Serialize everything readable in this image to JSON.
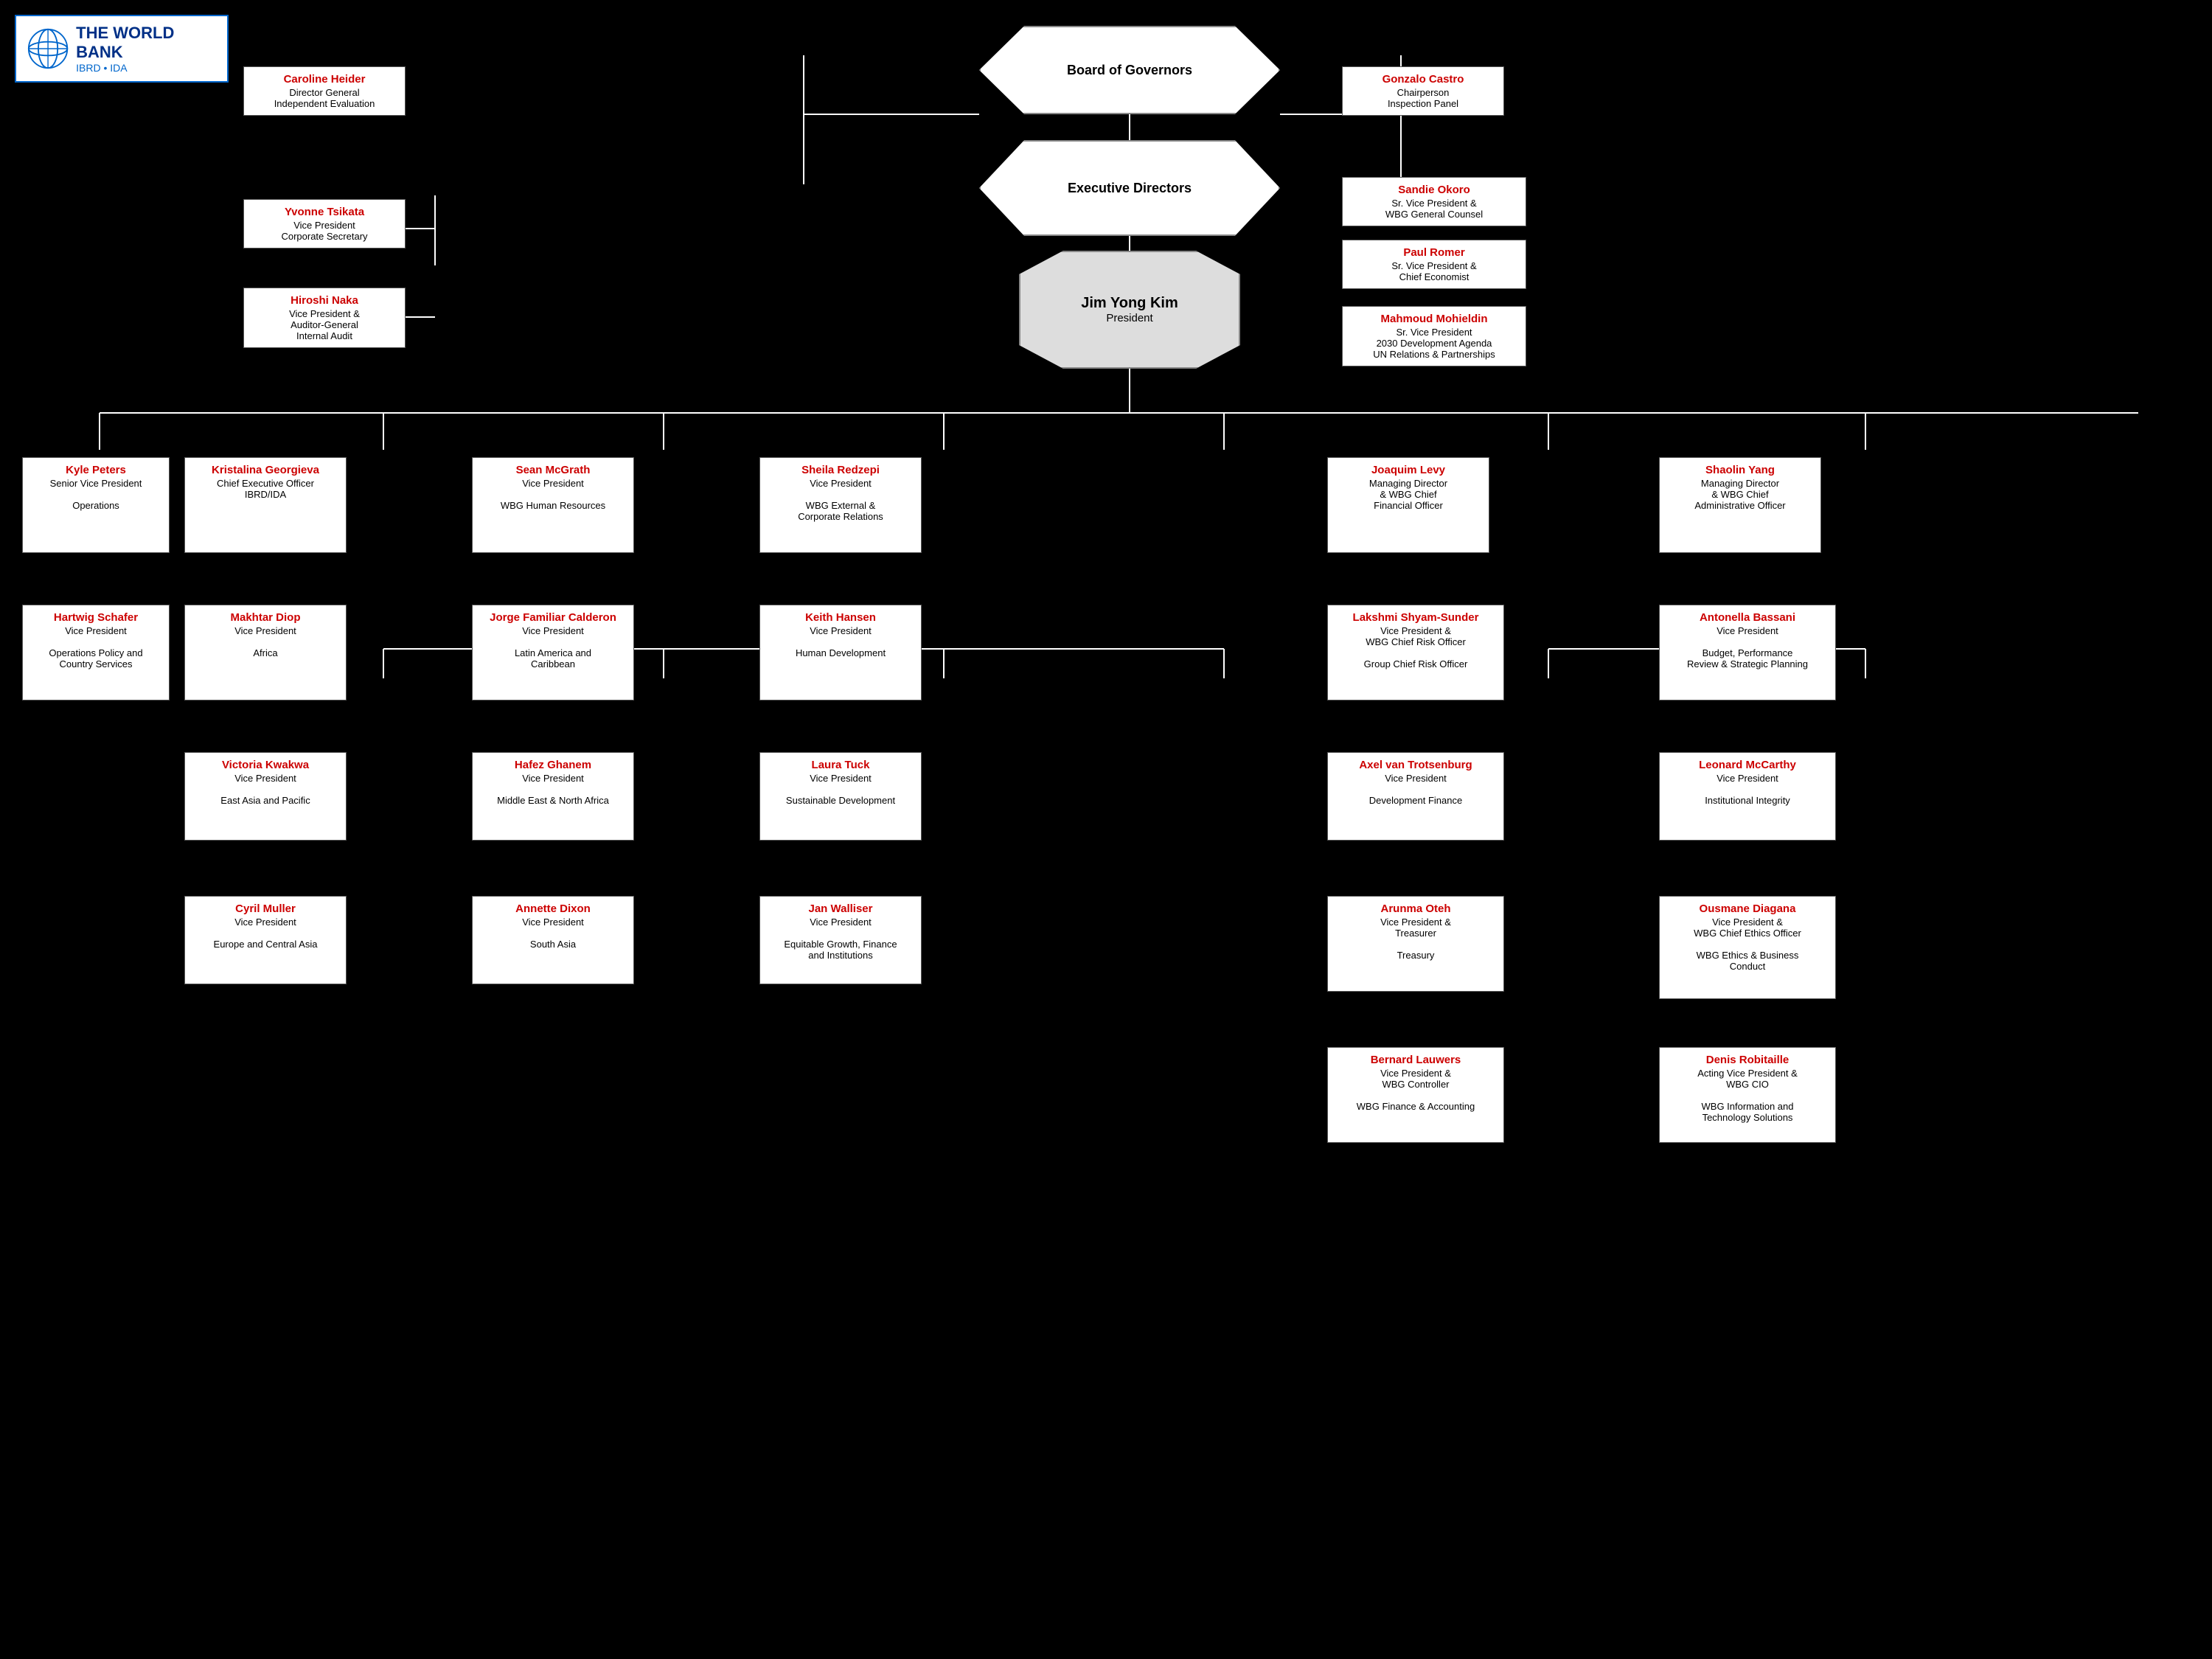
{
  "logo": {
    "title": "THE WORLD BANK",
    "sub": "IBRD • IDA"
  },
  "board": {
    "label": "Board of Governors"
  },
  "exec_directors": {
    "label": "Executive Directors"
  },
  "president": {
    "name": "Jim Yong Kim",
    "title": "President"
  },
  "cards": {
    "caroline": {
      "name": "Caroline Heider",
      "lines": [
        "Director General",
        "Independent Evaluation"
      ]
    },
    "yvonne": {
      "name": "Yvonne Tsikata",
      "lines": [
        "Vice President",
        "Corporate Secretary"
      ]
    },
    "hiroshi": {
      "name": "Hiroshi Naka",
      "lines": [
        "Vice President &",
        "Auditor-General",
        "Internal Audit"
      ]
    },
    "gonzalo": {
      "name": "Gonzalo Castro",
      "lines": [
        "Chairperson",
        "Inspection Panel"
      ]
    },
    "sandie": {
      "name": "Sandie Okoro",
      "lines": [
        "Sr. Vice President &",
        "WBG General Counsel"
      ]
    },
    "paul": {
      "name": "Paul Romer",
      "lines": [
        "Sr. Vice President &",
        "Chief Economist"
      ]
    },
    "mahmoud": {
      "name": "Mahmoud Mohieldin",
      "lines": [
        "Sr. Vice President",
        "2030 Development Agenda",
        "UN Relations & Partnerships"
      ]
    },
    "kyle": {
      "name": "Kyle Peters",
      "lines": [
        "Senior Vice President",
        "",
        "Operations"
      ]
    },
    "kristalina": {
      "name": "Kristalina Georgieva",
      "lines": [
        "Chief Executive Officer",
        "IBRD/IDA"
      ]
    },
    "sean": {
      "name": "Sean McGrath",
      "lines": [
        "Vice President",
        "",
        "WBG Human Resources"
      ]
    },
    "sheila": {
      "name": "Sheila Redzepi",
      "lines": [
        "Vice President",
        "",
        "WBG External &",
        "Corporate Relations"
      ]
    },
    "joaquim": {
      "name": "Joaquim Levy",
      "lines": [
        "Managing Director",
        "& WBG Chief",
        "Financial Officer"
      ]
    },
    "shaolin": {
      "name": "Shaolin Yang",
      "lines": [
        "Managing Director",
        "& WBG Chief",
        "Administrative Officer"
      ]
    },
    "hartwig": {
      "name": "Hartwig Schafer",
      "lines": [
        "Vice President",
        "",
        "Operations Policy and",
        "Country Services"
      ]
    },
    "makhtar": {
      "name": "Makhtar Diop",
      "lines": [
        "Vice President",
        "",
        "Africa"
      ]
    },
    "jorge": {
      "name": "Jorge Familiar Calderon",
      "lines": [
        "Vice President",
        "",
        "Latin America and",
        "Caribbean"
      ]
    },
    "keith": {
      "name": "Keith Hansen",
      "lines": [
        "Vice President",
        "",
        "Human Development"
      ]
    },
    "lakshmi": {
      "name": "Lakshmi Shyam-Sunder",
      "lines": [
        "Vice President &",
        "WBG Chief Risk Officer",
        "",
        "Group Chief Risk Officer"
      ]
    },
    "antonella": {
      "name": "Antonella Bassani",
      "lines": [
        "Vice President",
        "",
        "Budget, Performance",
        "Review & Strategic Planning"
      ]
    },
    "victoria": {
      "name": "Victoria Kwakwa",
      "lines": [
        "Vice President",
        "",
        "East Asia and Pacific"
      ]
    },
    "hafez": {
      "name": "Hafez Ghanem",
      "lines": [
        "Vice President",
        "",
        "Middle East & North Africa"
      ]
    },
    "laura": {
      "name": "Laura Tuck",
      "lines": [
        "Vice President",
        "",
        "Sustainable Development"
      ]
    },
    "axel": {
      "name": "Axel van Trotsenburg",
      "lines": [
        "Vice President",
        "",
        "Development Finance"
      ]
    },
    "leonard": {
      "name": "Leonard McCarthy",
      "lines": [
        "Vice President",
        "",
        "Institutional Integrity"
      ]
    },
    "cyril": {
      "name": "Cyril Muller",
      "lines": [
        "Vice President",
        "",
        "Europe and Central Asia"
      ]
    },
    "annette": {
      "name": "Annette Dixon",
      "lines": [
        "Vice President",
        "",
        "South Asia"
      ]
    },
    "jan": {
      "name": "Jan Walliser",
      "lines": [
        "Vice President",
        "",
        "Equitable Growth, Finance",
        "and Institutions"
      ]
    },
    "arunma": {
      "name": "Arunma Oteh",
      "lines": [
        "Vice President &",
        "Treasurer",
        "",
        "Treasury"
      ]
    },
    "ousmane": {
      "name": "Ousmane Diagana",
      "lines": [
        "Vice President &",
        "WBG Chief Ethics Officer",
        "",
        "WBG Ethics & Business",
        "Conduct"
      ]
    },
    "bernard": {
      "name": "Bernard Lauwers",
      "lines": [
        "Vice President &",
        "WBG Controller",
        "",
        "WBG Finance & Accounting"
      ]
    },
    "denis": {
      "name": "Denis Robitaille",
      "lines": [
        "Acting Vice President &",
        "WBG CIO",
        "",
        "WBG Information and",
        "Technology Solutions"
      ]
    }
  }
}
